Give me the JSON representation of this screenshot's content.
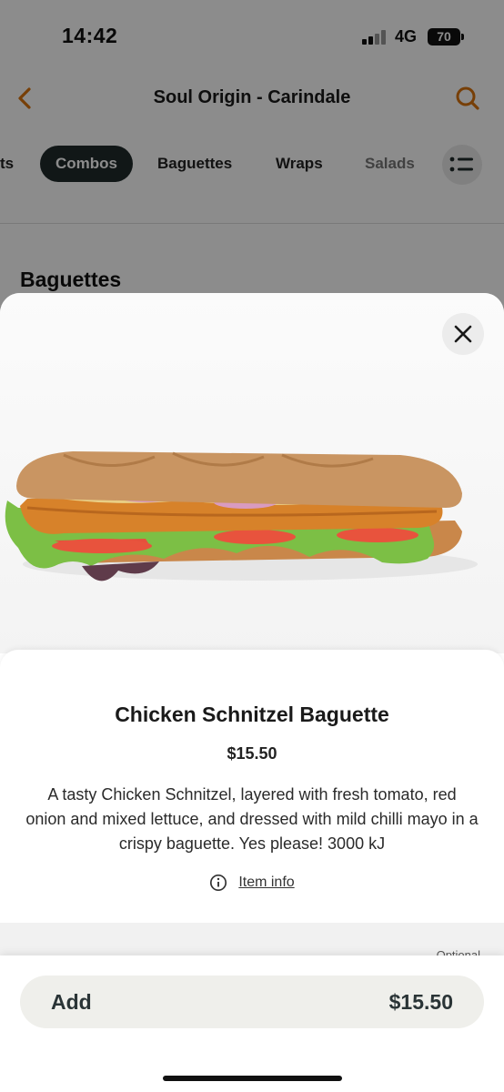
{
  "status_bar": {
    "time": "14:42",
    "network": "4G",
    "battery": "70"
  },
  "header": {
    "title": "Soul Origin - Carindale"
  },
  "tabs": [
    {
      "label": "ts"
    },
    {
      "label": "Combos",
      "active": true
    },
    {
      "label": "Baguettes"
    },
    {
      "label": "Wraps"
    },
    {
      "label": "Salads"
    }
  ],
  "section": {
    "title": "Baguettes"
  },
  "item": {
    "name": "Chicken Schnitzel Baguette",
    "price": "$15.50",
    "description": "A tasty Chicken Schnitzel, layered with fresh tomato, red onion and mixed lettuce, and dressed with mild chilli mayo in a crispy baguette. Yes please! 3000 kJ",
    "info_link": "Item info"
  },
  "options": {
    "tag": "Optional"
  },
  "footer": {
    "add_label": "Add",
    "add_price": "$15.50"
  },
  "colors": {
    "accent": "#d9730d",
    "active_tab": "#1f2a2b",
    "button_bg": "#efefeb"
  },
  "icons": [
    "chevron-left-icon",
    "search-icon",
    "list-icon",
    "close-icon",
    "info-icon"
  ]
}
